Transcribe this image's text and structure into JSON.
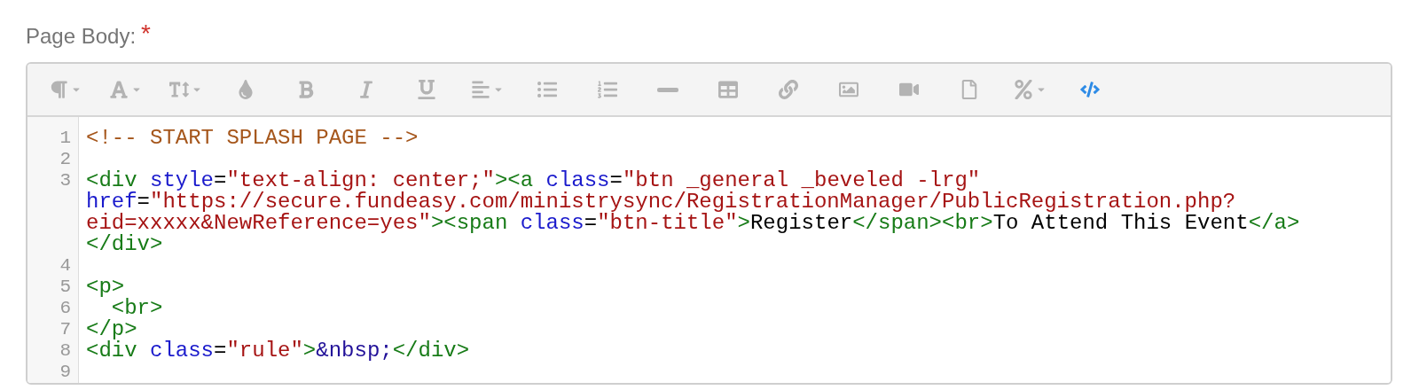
{
  "field": {
    "label": "Page Body:",
    "required_mark": "*"
  },
  "toolbar": [
    {
      "kind": "paragraph",
      "dropdown": true,
      "active": false
    },
    {
      "kind": "font",
      "dropdown": true,
      "active": false
    },
    {
      "kind": "text-height",
      "dropdown": true,
      "active": false
    },
    {
      "kind": "color",
      "dropdown": false,
      "active": false
    },
    {
      "kind": "bold",
      "dropdown": false,
      "active": false
    },
    {
      "kind": "italic",
      "dropdown": false,
      "active": false
    },
    {
      "kind": "underline",
      "dropdown": false,
      "active": false
    },
    {
      "kind": "align",
      "dropdown": true,
      "active": false
    },
    {
      "kind": "bullet-list",
      "dropdown": false,
      "active": false
    },
    {
      "kind": "numbered-list",
      "dropdown": false,
      "active": false
    },
    {
      "kind": "rule",
      "dropdown": false,
      "active": false
    },
    {
      "kind": "table",
      "dropdown": false,
      "active": false
    },
    {
      "kind": "link",
      "dropdown": false,
      "active": false
    },
    {
      "kind": "image",
      "dropdown": false,
      "active": false
    },
    {
      "kind": "video",
      "dropdown": false,
      "active": false
    },
    {
      "kind": "file",
      "dropdown": false,
      "active": false
    },
    {
      "kind": "special",
      "dropdown": true,
      "active": false
    },
    {
      "kind": "code-view",
      "dropdown": false,
      "active": true
    }
  ],
  "code_lines": [
    {
      "number": "1",
      "rows": [
        {
          "tokens": [
            {
              "text": "<!-- START SPLASH PAGE -->",
              "kind": "comment"
            }
          ]
        }
      ]
    },
    {
      "number": "2",
      "rows": [
        {}
      ]
    },
    {
      "number": "3",
      "rows": [
        {
          "tokens": [
            {
              "text": "<div",
              "kind": "tag"
            },
            {
              "text": " style",
              "kind": "attr"
            },
            {
              "text": "=",
              "kind": "text"
            },
            {
              "text": "\"text-align: center;\"",
              "kind": "string"
            },
            {
              "text": "><a",
              "kind": "tag"
            },
            {
              "text": " class",
              "kind": "attr"
            },
            {
              "text": "=",
              "kind": "text"
            },
            {
              "text": "\"btn _general _beveled -lrg\"",
              "kind": "string"
            }
          ]
        },
        {
          "tokens": [
            {
              "text": "href",
              "kind": "attr"
            },
            {
              "text": "=",
              "kind": "text"
            },
            {
              "text": "\"https://secure.fundeasy.com/ministrysync/RegistrationManager/PublicRegistration.php?",
              "kind": "string"
            }
          ]
        },
        {
          "tokens": [
            {
              "text": "eid=xxxxx&NewReference=yes\"",
              "kind": "string"
            },
            {
              "text": "><span",
              "kind": "tag"
            },
            {
              "text": " class",
              "kind": "attr"
            },
            {
              "text": "=",
              "kind": "text"
            },
            {
              "text": "\"btn-title\"",
              "kind": "string"
            },
            {
              "text": ">",
              "kind": "tag"
            },
            {
              "text": "Register",
              "kind": "text"
            },
            {
              "text": "</span><br>",
              "kind": "tag"
            },
            {
              "text": "To Attend This Event",
              "kind": "text"
            },
            {
              "text": "</a>",
              "kind": "tag"
            }
          ]
        },
        {
          "tokens": [
            {
              "text": "</div>",
              "kind": "tag"
            }
          ]
        }
      ]
    },
    {
      "number": "4",
      "rows": [
        {}
      ]
    },
    {
      "number": "5",
      "rows": [
        {
          "tokens": [
            {
              "text": "<p>",
              "kind": "tag"
            }
          ]
        }
      ]
    },
    {
      "number": "6",
      "rows": [
        {
          "tokens": [
            {
              "text": "  <br>",
              "kind": "tag"
            }
          ]
        }
      ]
    },
    {
      "number": "7",
      "rows": [
        {
          "tokens": [
            {
              "text": "</p>",
              "kind": "tag"
            }
          ]
        }
      ]
    },
    {
      "number": "8",
      "rows": [
        {
          "tokens": [
            {
              "text": "<div",
              "kind": "tag"
            },
            {
              "text": " class",
              "kind": "attr"
            },
            {
              "text": "=",
              "kind": "text"
            },
            {
              "text": "\"rule\"",
              "kind": "string"
            },
            {
              "text": ">",
              "kind": "tag"
            },
            {
              "text": "&nbsp;",
              "kind": "entity"
            },
            {
              "text": "</div>",
              "kind": "tag"
            }
          ]
        }
      ]
    },
    {
      "number": "9",
      "rows": [
        {}
      ]
    }
  ]
}
